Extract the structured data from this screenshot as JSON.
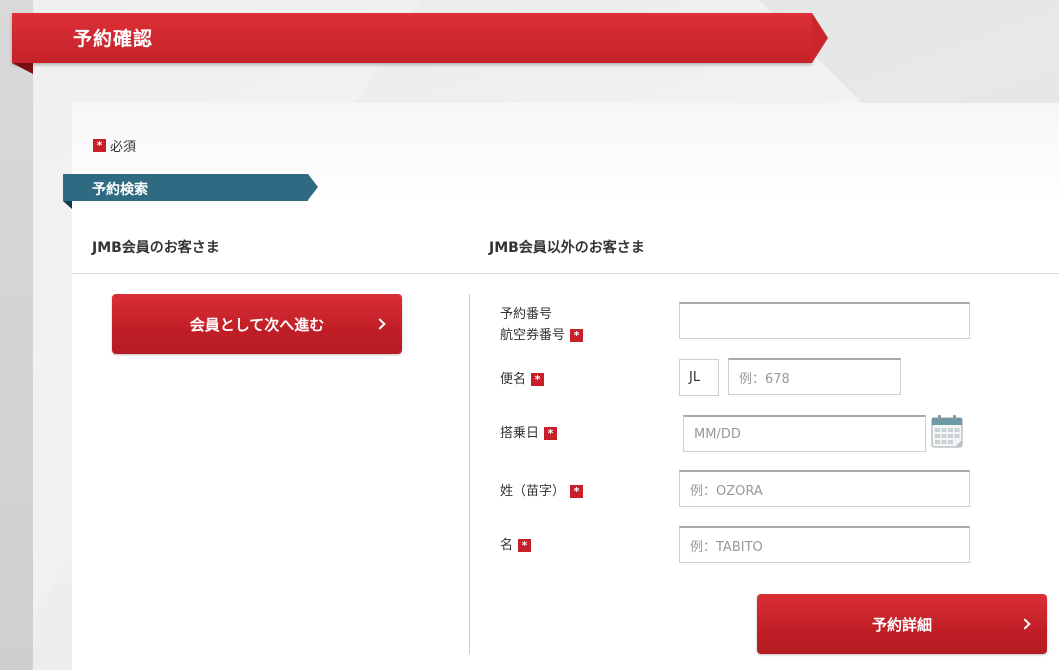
{
  "page": {
    "title": "予約確認"
  },
  "required_note": {
    "mark": "*",
    "label": "必須"
  },
  "section": {
    "title": "予約検索"
  },
  "columns": {
    "member_heading": "JMB会員のお客さま",
    "nonmember_heading": "JMB会員以外のお客さま"
  },
  "member_button": {
    "label": "会員として次へ進む"
  },
  "form": {
    "booking_label_line1": "予約番号",
    "booking_label_line2": "航空券番号",
    "booking_value": "",
    "flight_label": "便名",
    "flight_prefix": "JL",
    "flight_placeholder": "例：678",
    "date_label": "搭乗日",
    "date_placeholder": "MM/DD",
    "lastname_label": "姓（苗字）",
    "lastname_placeholder": "例：OZORA",
    "firstname_label": "名",
    "firstname_placeholder": "例：TABITO"
  },
  "details_button": {
    "label": "予約詳細"
  },
  "icons": {
    "required": "asterisk-badge",
    "calendar": "calendar-icon",
    "next": "chevron-right-icon"
  },
  "colors": {
    "brand_red": "#c8202a",
    "section_teal": "#2e6b82"
  }
}
